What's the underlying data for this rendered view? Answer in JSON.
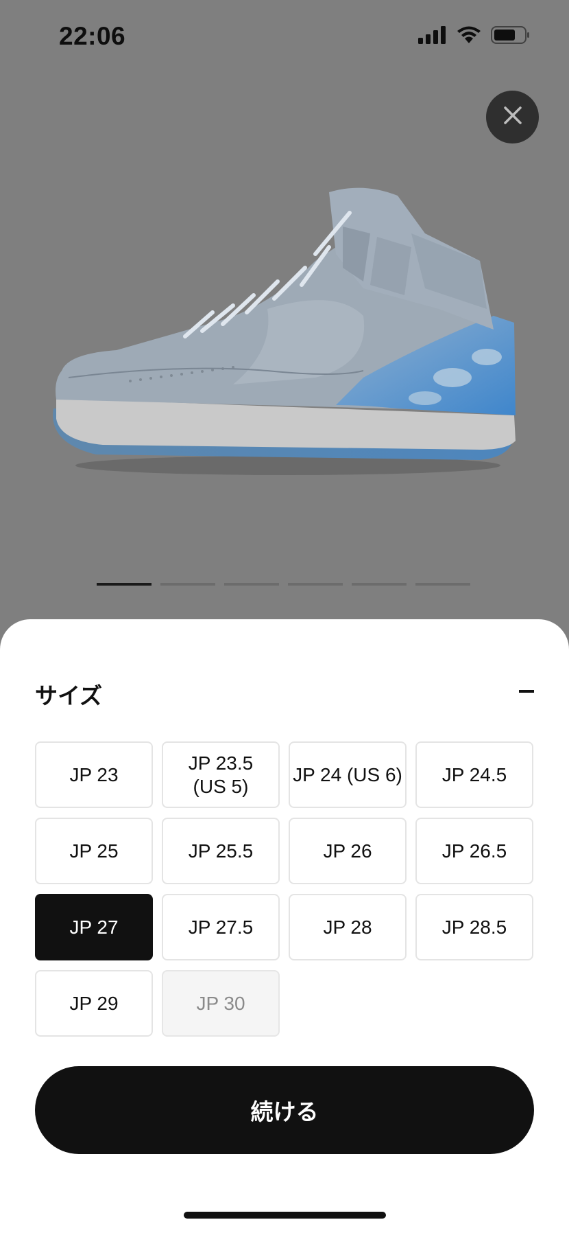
{
  "status_bar": {
    "time": "22:06",
    "icons": [
      "cellular-signal-icon",
      "wifi-icon",
      "battery-icon"
    ]
  },
  "close_icon": "close-icon",
  "carousel": {
    "count": 6,
    "active_index": 0
  },
  "size_sheet": {
    "title": "サイズ",
    "collapse_icon": "minus-icon",
    "sizes": [
      {
        "label": "JP 23",
        "state": "available"
      },
      {
        "label": "JP 23.5\n(US 5)",
        "state": "available"
      },
      {
        "label": "JP 24 (US 6)",
        "state": "available"
      },
      {
        "label": "JP 24.5",
        "state": "available"
      },
      {
        "label": "JP 25",
        "state": "available"
      },
      {
        "label": "JP 25.5",
        "state": "available"
      },
      {
        "label": "JP 26",
        "state": "available"
      },
      {
        "label": "JP 26.5",
        "state": "available"
      },
      {
        "label": "JP 27",
        "state": "selected"
      },
      {
        "label": "JP 27.5",
        "state": "available"
      },
      {
        "label": "JP 28",
        "state": "available"
      },
      {
        "label": "JP 28.5",
        "state": "available"
      },
      {
        "label": "JP 29",
        "state": "available"
      },
      {
        "label": "JP 30",
        "state": "disabled"
      }
    ],
    "continue_label": "続ける"
  },
  "colors": {
    "overlay": "#7f7f7f",
    "primary": "#111111",
    "sheet_bg": "#ffffff"
  }
}
